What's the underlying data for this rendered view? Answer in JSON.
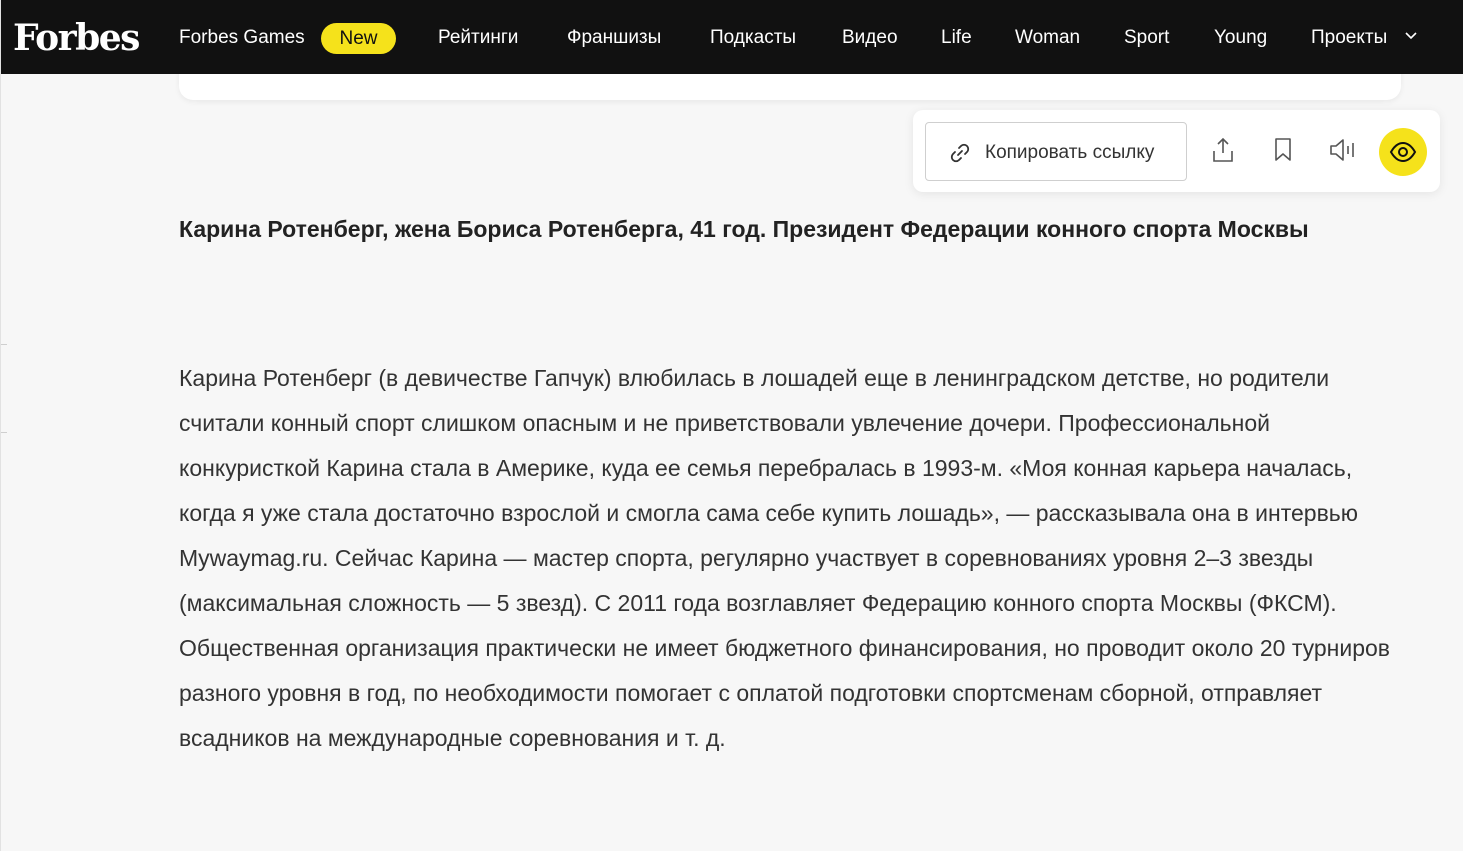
{
  "header": {
    "logo": "Forbes",
    "nav": [
      {
        "label": "Forbes Games"
      },
      {
        "label": "New"
      },
      {
        "label": "Рейтинги"
      },
      {
        "label": "Франшизы"
      },
      {
        "label": "Подкасты"
      },
      {
        "label": "Видео"
      },
      {
        "label": "Life"
      },
      {
        "label": "Woman"
      },
      {
        "label": "Sport"
      },
      {
        "label": "Young"
      },
      {
        "label": "Проекты"
      }
    ]
  },
  "share": {
    "copy_label": "Копировать ссылку",
    "icons": [
      "link-icon",
      "share-icon",
      "bookmark-icon",
      "audio-icon",
      "eye-icon"
    ]
  },
  "article": {
    "headline": "Карина Ротенберг, жена  Бориса Ротенберга, 41 год. Президент Федерации конного спорта Москвы",
    "paragraph": "Карина Ротенберг (в девичестве Гапчук) влюбилась в лошадей еще в ленинградском детстве, но родители считали конный спорт слишком опасным и не приветствовали увлечение дочери. Профессиональной конкуристкой Карина стала в Америке, куда ее семья перебралась в 1993-м. «Моя конная карьера началась, когда я уже стала достаточно взрослой и смогла сама себе купить лошадь», — рассказывала она в  интервью Mywaymag.ru. Сейчас Карина — мастер спорта, регулярно участвует в соревнованиях уровня 2–3 звезды (максимальная сложность — 5 звезд). С 2011 года возглавляет Федерацию конного спорта Москвы (ФКСМ). Общественная организация практически не имеет бюджетного финансирования, но проводит около 20 турниров разного уровня в год, по необходимости помогает с оплатой подготовки спортсменам сборной, отправляет всадников на международные соревнования и т. д."
  },
  "colors": {
    "header_bg": "#111111",
    "accent_yellow": "#f5e21b",
    "page_bg": "#f7f7f7",
    "text": "#333333"
  }
}
